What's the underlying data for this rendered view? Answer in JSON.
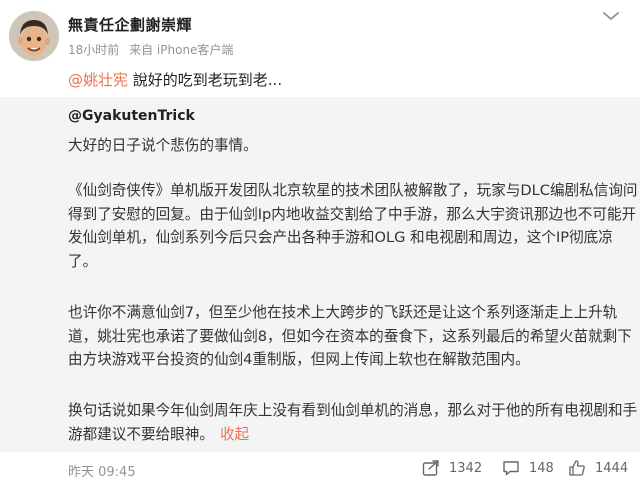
{
  "post": {
    "author": "無責任企劃謝崇輝",
    "time": "18小时前",
    "source": "来自 iPhone客户端",
    "mention": "@姚壮宪",
    "text": " 說好的吃到老玩到老..."
  },
  "quoted": {
    "author": "@GyakutenTrick",
    "paragraphs": [
      "大好的日子说个悲伤的事情。",
      "《仙剑奇侠传》单机版开发团队北京软星的技术团队被解散了，玩家与DLC编剧私信询问得到了安慰的回复。由于仙剑Ip内地收益交割给了中手游，那么大宇资讯那边也不可能开发仙剑单机，仙剑系列今后只会产出各种手游和OLG 和电视剧和周边，这个IP彻底凉了。",
      "也许你不满意仙剑7，但至少他在技术上大跨步的飞跃还是让这个系列逐渐走上上升轨道，姚壮宪也承诺了要做仙剑8，但如今在资本的蚕食下，这系列最后的希望火苗就剩下由方块游戏平台投资的仙剑4重制版，但网上传闻上软也在解散范围内。",
      "换句话说如果今年仙剑周年庆上没有看到仙剑单机的消息，那么对于他的所有电视剧和手游都建议不要给眼神。"
    ],
    "collapse_label": "收起",
    "timestamp": "昨天 09:45"
  },
  "actions": {
    "repost_count": "1342",
    "comment_count": "148",
    "like_count": "1444"
  },
  "colors": {
    "link": "#eb7350",
    "quoted_bg": "#f4f4f4",
    "meta_text": "#939393"
  },
  "icons": [
    "avatar",
    "chevron-down-icon",
    "share-icon",
    "comment-icon",
    "like-icon"
  ]
}
